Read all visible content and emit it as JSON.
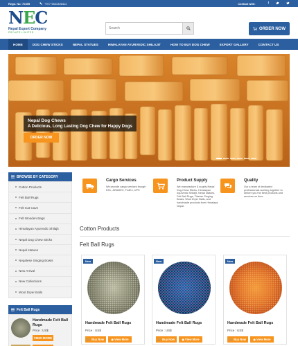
{
  "topbar": {
    "reg": "Regd. No: 70495",
    "phone": "+977 9841306412",
    "contact_label": "Contact with:",
    "social": [
      "facebook-icon",
      "twitter-icon",
      "twitter-icon"
    ]
  },
  "logo": {
    "mark_n": "N",
    "mark_e": "E",
    "mark_c": "C",
    "name": "Nepal Export Company",
    "sub": "PRIVATE LIMITED"
  },
  "search": {
    "placeholder": "Search",
    "icon": "search-icon"
  },
  "order_button": {
    "label": "ORDER NOW",
    "icon": "cart-icon"
  },
  "nav": {
    "items": [
      {
        "label": "HOME"
      },
      {
        "label": "DOG CHEW STICKS"
      },
      {
        "label": "NEPAL STATUES"
      },
      {
        "label": "HIMALAYAN AYURVEDIC SHILAJIT"
      },
      {
        "label": "HOW TO BUY DOG CHEW"
      },
      {
        "label": "EXPORT GALLERY"
      },
      {
        "label": "CONTACT US"
      }
    ]
  },
  "hero": {
    "title": "Nepal Dog Chews",
    "subtitle": "A Delicious, Long Lasting Dog Chew for Happy Dogs",
    "button": "ORDER NOW"
  },
  "sidebar": {
    "heading": "BROWSE BY CATEGORY",
    "items": [
      {
        "label": "Cotton Products"
      },
      {
        "label": "Felt Ball Rugs"
      },
      {
        "label": "Felt Cat Cave"
      },
      {
        "label": "Felt Wooden Bags"
      },
      {
        "label": "Himalayan Ayurvedic Shilajit"
      },
      {
        "label": "Nepal Dog Chew Sticks"
      },
      {
        "label": "Nepal statues"
      },
      {
        "label": "Nepalese Singing Bowls"
      },
      {
        "label": "New Arrival"
      },
      {
        "label": "New Collections"
      },
      {
        "label": "Wool Dryer Balls"
      }
    ],
    "featured_heading": "Felt Ball Rugs",
    "featured_product": {
      "name": "Handmade Felt Ball Rugs",
      "price": "Price : US$",
      "button": "VIEW MORE"
    }
  },
  "services": [
    {
      "title": "Cargo Services",
      "icon": "truck-icon",
      "desc": "We provide cargo services though DHL, ARAMEX, FedEx, UPS"
    },
    {
      "title": "Product Supply",
      "icon": "cart-icon",
      "desc": "We manufacture & supply Nepal Dog Chew Sticks, Himalayan Ayurvedic Shilajit, Nepal statues, Felt Ball Rugs, Tibetan Singing Bowls, Wool Dryer Balls, and handmade products from Himalaya Nepal."
    },
    {
      "title": "Quality",
      "icon": "chat-icon",
      "desc": "Our a team of dedicated professionals working together to deliver you the best products and services on time."
    }
  ],
  "sections": {
    "cotton": "Cotton Products",
    "felt": "Felt Ball Rugs"
  },
  "products": [
    {
      "badge": "New",
      "name": "Handmade Felt Ball Rugs",
      "price": "Price : US$",
      "buy": "Buy Now",
      "more": "View More"
    },
    {
      "badge": "New",
      "name": "Handmade Felt Ball Rugs",
      "price": "Price : US$",
      "buy": "Buy Now",
      "more": "View More"
    },
    {
      "badge": "New",
      "name": "Handmade Felt Ball Rugs",
      "price": "Price : US$",
      "buy": "Buy Now",
      "more": "View More"
    }
  ],
  "colors": {
    "primary": "#2c5fa0",
    "accent": "#f7941d",
    "logo_green": "#3aa64a"
  }
}
